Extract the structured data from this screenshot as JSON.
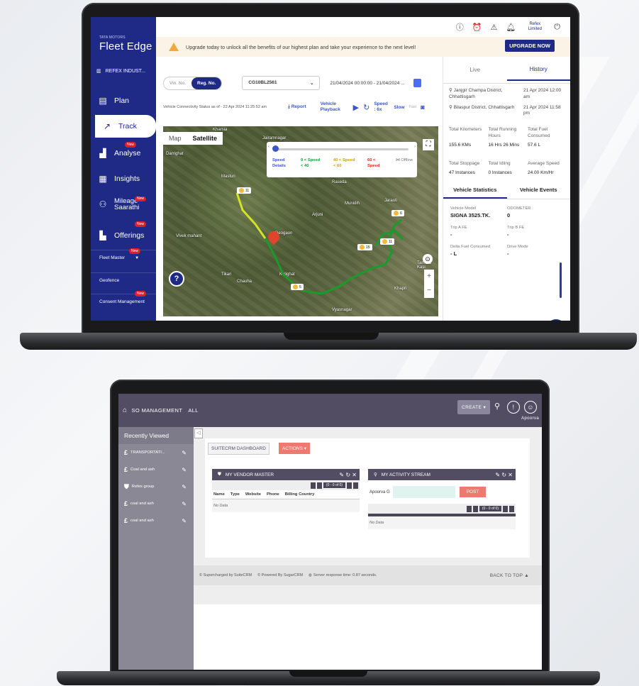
{
  "fleet_edge": {
    "logo_tag": "TATA MOTORS",
    "logo": "Fleet Edge",
    "org": "REFEX INDUST...",
    "new_badge": "New",
    "nav": [
      {
        "label": "Plan",
        "icon": "plan-icon"
      },
      {
        "label": "Track",
        "icon": "track-icon"
      },
      {
        "label": "Analyse",
        "icon": "analyse-icon"
      },
      {
        "label": "Insights",
        "icon": "insights-icon"
      },
      {
        "label": "Mileage Saarathi",
        "icon": "mileage-icon"
      },
      {
        "label": "Offerings",
        "icon": "offerings-icon"
      }
    ],
    "sub_nav": [
      "Fleet Master",
      "Geofence",
      "Consent Management"
    ],
    "account_name": "Refex Limited",
    "banner_text": "Upgrade today to unlock all the benefits of our highest plan and take your experience to the next level!",
    "upgrade_label": "UPGRADE NOW",
    "vin_label": "Vin. No.",
    "reg_label": "Reg. No.",
    "vehicle": "CG10BL2561",
    "date_range": "21/04/2024 00:00:00 - 21/04/2024 ...",
    "status_text": "Vehicle Connectivity Status as of - 22 Apr 2024 11:25:52 am",
    "report_label": "Report",
    "playback_label": "Vehicle Playback",
    "speed_label": "Speed : 6x",
    "slow_label": "Slow",
    "fast_label": "Fast",
    "map_tab": "Map",
    "satellite_tab": "Satellite",
    "speed_details": "Speed Details",
    "speed_green": "0 < Speed < 40",
    "speed_yellow": "40 < Speed < 60",
    "speed_red": "60 < Speed",
    "offline_label": "Offline",
    "places": [
      "Kharsia",
      "Darrighat",
      "Jairamnagar",
      "Masturi",
      "Raseda",
      "Munidih",
      "Vivek mahant",
      "Deogaon",
      "Arjuni",
      "Tikari",
      "Chauha",
      "Kulighat",
      "Vyasnagar",
      "Khapri",
      "Tamera Kasi",
      "Jaraoti"
    ],
    "markers": [
      "11",
      "15",
      "11",
      "6",
      "5"
    ],
    "tabs": {
      "live": "Live",
      "history": "History"
    },
    "loc_from": "Janjgir Champa District, Chhattisgarh",
    "loc_from_time": "21 Apr 2024 12:00 am",
    "loc_to": "Bilaspur District, Chhattisgarh",
    "loc_to_time": "21 Apr 2024 11:58 pm",
    "stat_heads_1": [
      "Total Kilometers",
      "Total Running Hours",
      "Total Fuel Consumed"
    ],
    "stat_vals_1": [
      "155.6 KMs",
      "16 Hrs 26 Mins",
      "57.6 L"
    ],
    "stat_heads_2": [
      "Total Stoppage",
      "Total Idling",
      "Average Speed"
    ],
    "stat_vals_2": [
      "47 Instances",
      "0 Instances",
      "24.00 Km/Hr"
    ],
    "vtab_stats": "Vehicle Statistics",
    "vtab_events": "Vehicle Events",
    "vehicle_model_label": "Vehicle Model",
    "vehicle_model": "SIGNA 3525.TK.",
    "odometer_label": "ODOMETER",
    "odometer": "0",
    "trip_a_label": "Trip A FE",
    "trip_a": "-",
    "trip_b_label": "Trip B FE",
    "trip_b": "-",
    "delta_label": "Delta Fuel Consumed",
    "delta": "- L",
    "drive_label": "Drive Mode",
    "drive": "-"
  },
  "suitecrm": {
    "module_title": "SO MANAGEMENT",
    "filter": "ALL",
    "create_label": "CREATE",
    "user": "Apoorva",
    "recently_viewed": "Recently Viewed",
    "recent": [
      {
        "label": "TRANSPORTATI...",
        "icon": "pound-icon"
      },
      {
        "label": "Coal and ash",
        "icon": "pound-icon"
      },
      {
        "label": "Refex group",
        "icon": "shield-icon"
      },
      {
        "label": "coal and ash",
        "icon": "pound-icon"
      },
      {
        "label": "coal and ash",
        "icon": "pound-icon"
      }
    ],
    "dashboard_tab": "SUITECRM DASHBOARD",
    "actions_label": "ACTIONS",
    "vendor_title": "MY VENDOR MASTER",
    "activity_title": "MY ACTIVITY STREAM",
    "pager_text": "(0 - 0 of 0)",
    "columns": [
      "Name",
      "Type",
      "Website",
      "Phone",
      "Billing Country"
    ],
    "no_data": "No Data",
    "post_user": "Apoorva G",
    "post_label": "POST",
    "footer_1": "© Supercharged by SuiteCRM",
    "footer_2": "© Powered By SugarCRM",
    "footer_3": "Server response time: 0.87 seconds.",
    "back_to_top": "BACK TO TOP"
  },
  "colors": {
    "fleet_navy": "#1e2a86",
    "crm_purple": "#534d64",
    "crm_coral": "#f0796f"
  }
}
